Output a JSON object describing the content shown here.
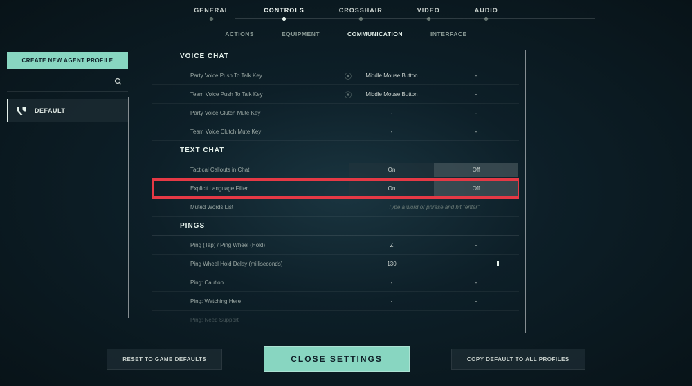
{
  "topNav": {
    "items": [
      {
        "label": "GENERAL"
      },
      {
        "label": "CONTROLS"
      },
      {
        "label": "CROSSHAIR"
      },
      {
        "label": "VIDEO"
      },
      {
        "label": "AUDIO"
      }
    ]
  },
  "subNav": {
    "items": [
      {
        "label": "ACTIONS"
      },
      {
        "label": "EQUIPMENT"
      },
      {
        "label": "COMMUNICATION"
      },
      {
        "label": "INTERFACE"
      }
    ]
  },
  "sidebar": {
    "createButton": "CREATE NEW AGENT PROFILE",
    "profileLabel": "DEFAULT"
  },
  "sections": {
    "voiceChat": {
      "header": "VOICE CHAT",
      "rows": [
        {
          "label": "Party Voice Push To Talk Key",
          "val1": "Middle Mouse Button",
          "val2": "-",
          "hasClear": true
        },
        {
          "label": "Team Voice Push To Talk Key",
          "val1": "Middle Mouse Button",
          "val2": "-",
          "hasClear": true
        },
        {
          "label": "Party Voice Clutch Mute Key",
          "val1": "-",
          "val2": "-"
        },
        {
          "label": "Team Voice Clutch Mute Key",
          "val1": "-",
          "val2": "-"
        }
      ]
    },
    "textChat": {
      "header": "TEXT CHAT",
      "toggleRows": [
        {
          "label": "Tactical Callouts in Chat",
          "on": "On",
          "off": "Off",
          "selected": "off"
        },
        {
          "label": "Explicit Language Filter",
          "on": "On",
          "off": "Off",
          "selected": "off",
          "highlighted": true
        }
      ],
      "mutedLabel": "Muted Words List",
      "mutedPlaceholder": "Type a word or phrase and hit \"enter\""
    },
    "pings": {
      "header": "PINGS",
      "rows": [
        {
          "label": "Ping (Tap) / Ping Wheel (Hold)",
          "val1": "Z",
          "val2": "-"
        },
        {
          "label": "Ping Wheel Hold Delay (milliseconds)",
          "val1": "130",
          "slider": true
        },
        {
          "label": "Ping: Caution",
          "val1": "-",
          "val2": "-"
        },
        {
          "label": "Ping: Watching Here",
          "val1": "-",
          "val2": "-"
        },
        {
          "label": "Ping: Need Support",
          "val1": "-",
          "val2": "-"
        }
      ]
    }
  },
  "bottomBar": {
    "reset": "RESET TO GAME DEFAULTS",
    "close": "CLOSE SETTINGS",
    "copy": "COPY DEFAULT TO ALL PROFILES"
  }
}
